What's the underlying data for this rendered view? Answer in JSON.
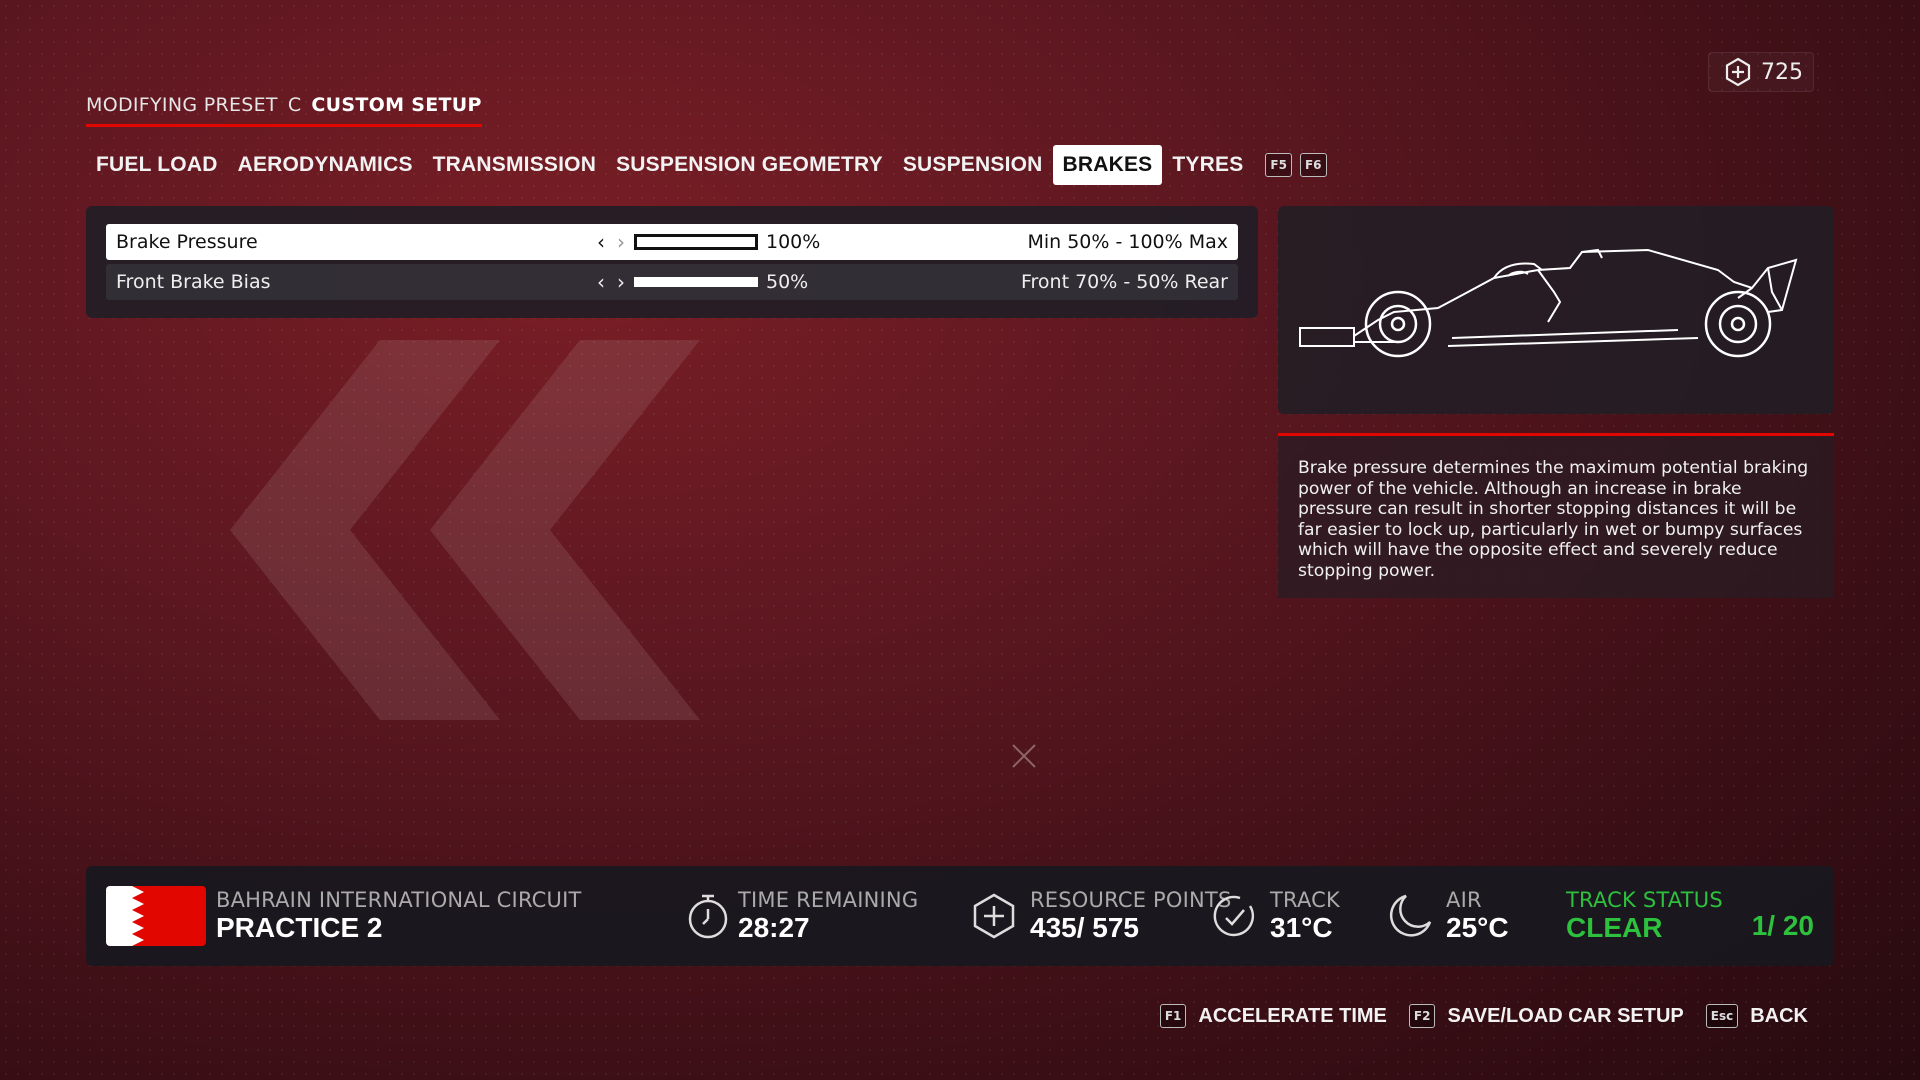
{
  "currency": {
    "icon": "resource-hex-icon",
    "amount": "725"
  },
  "preset": {
    "label": "MODIFYING PRESET",
    "letter": "C",
    "name": "CUSTOM SETUP"
  },
  "tabs": [
    {
      "label": "FUEL LOAD"
    },
    {
      "label": "AERODYNAMICS"
    },
    {
      "label": "TRANSMISSION"
    },
    {
      "label": "SUSPENSION GEOMETRY"
    },
    {
      "label": "SUSPENSION"
    },
    {
      "label": "BRAKES",
      "active": true
    },
    {
      "label": "TYRES"
    }
  ],
  "tab_keys": {
    "prev": "F5",
    "next": "F6"
  },
  "settings": [
    {
      "name": "Brake Pressure",
      "value": "100%",
      "fill_fraction": 1.0,
      "range": "Min 50% - 100% Max",
      "selected": true
    },
    {
      "name": "Front Brake Bias",
      "value": "50%",
      "fill_fraction": 1.0,
      "range": "Front 70% - 50% Rear",
      "selected": false
    }
  ],
  "description": "Brake pressure determines the maximum potential braking power of the vehicle. Although an increase in brake pressure can result in shorter stopping distances it will be far easier to lock up, particularly in wet or bumpy surfaces which will have the opposite effect and severely reduce stopping power.",
  "info": {
    "circuit": "BAHRAIN INTERNATIONAL CIRCUIT",
    "session": "PRACTICE 2",
    "time_label": "TIME REMAINING",
    "time_value": "28:27",
    "rp_label": "RESOURCE POINTS",
    "rp_value": "435/ 575",
    "track_label": "TRACK",
    "track_value": "31°C",
    "air_label": "AIR",
    "air_value": "25°C",
    "status_label": "TRACK STATUS",
    "status_value": "CLEAR",
    "laps": "1/ 20"
  },
  "hints": [
    {
      "key": "F1",
      "label": "ACCELERATE TIME"
    },
    {
      "key": "F2",
      "label": "SAVE/LOAD CAR SETUP"
    },
    {
      "key": "Esc",
      "label": "BACK"
    }
  ],
  "colors": {
    "accent": "#e10600",
    "status_green": "#2ec13d",
    "panel": "#1e1e26"
  }
}
